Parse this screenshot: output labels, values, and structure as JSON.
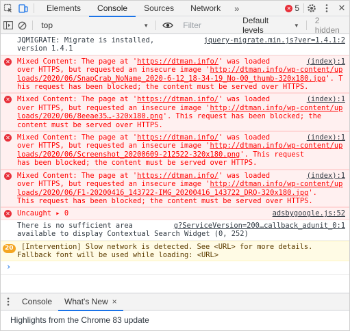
{
  "tabs": [
    {
      "label": "Elements"
    },
    {
      "label": "Console"
    },
    {
      "label": "Sources"
    },
    {
      "label": "Network"
    }
  ],
  "more_tabs_glyph": "»",
  "error_count": "5",
  "toolbar": {
    "context": "top",
    "filter_placeholder": "Filter",
    "levels": "Default levels",
    "hidden": "2 hidden"
  },
  "messages": [
    {
      "type": "info",
      "text": "JQMIGRATE: Migrate is installed,\nversion 1.4.1",
      "source": "jquery-migrate.min.js?ver=1.4.1:2"
    },
    {
      "type": "error",
      "prefix": "Mixed Content: The page at '",
      "url1": "https://dtman.info/",
      "mid": "' was loaded\nover HTTPS, but requested an insecure image '",
      "url2": "http://dtman.info/wp-content/uploads/2020/06/SnapCrab_NoName_2020-6-12_18-34-19_No-00_thumb-320x180.jpg",
      "suffix": "'. This request has been blocked; the content must be served over HTTPS.",
      "source": "(index):1"
    },
    {
      "type": "error",
      "prefix": "Mixed Content: The page at '",
      "url1": "https://dtman.info/",
      "mid": "' was loaded\nover HTTPS, but requested an insecure image '",
      "url2": "http://dtman.info/wp-content/uploads/2020/06/8eeae35…-320x180.png",
      "suffix": "'. This request has been blocked; the\ncontent must be served over HTTPS.",
      "source": "(index):1"
    },
    {
      "type": "error",
      "prefix": "Mixed Content: The page at '",
      "url1": "https://dtman.info/",
      "mid": "' was loaded\nover HTTPS, but requested an insecure image '",
      "url2": "http://dtman.info/wp-content/uploads/2020/06/Screenshot_20200609-212522-320x180.png",
      "suffix": "'. This request\nhas been blocked; the content must be served over HTTPS.",
      "source": "(index):1"
    },
    {
      "type": "error",
      "prefix": "Mixed Content: The page at '",
      "url1": "https://dtman.info/",
      "mid": "' was loaded\nover HTTPS, but requested an insecure image '",
      "url2": "http://dtman.info/wp-content/uploads/2020/06/F1-20200416_143722-IMG_20200416_143722_DRO-320x180.jpg",
      "suffix": "'.\nThis request has been blocked; the content must be served over HTTPS.",
      "source": "(index):1"
    },
    {
      "type": "error-short",
      "text": "Uncaught ▸ 0",
      "source": "adsbygoogle.js:52"
    },
    {
      "type": "info",
      "text": "There is no sufficient area\navailable to display Contextual Search Widget (0, 252)",
      "source": "g?ServiceVersion=200…callback_adunit_0:1"
    },
    {
      "type": "warn",
      "badge": "20",
      "text": "[Intervention] Slow network is detected. See <URL> for more details.\nFallback font will be used while loading: <URL>"
    }
  ],
  "prompt": "›",
  "drawer": {
    "tabs": [
      {
        "label": "Console"
      },
      {
        "label": "What's New"
      }
    ],
    "close": "×",
    "highlights": "Highlights from the Chrome 83 update"
  }
}
